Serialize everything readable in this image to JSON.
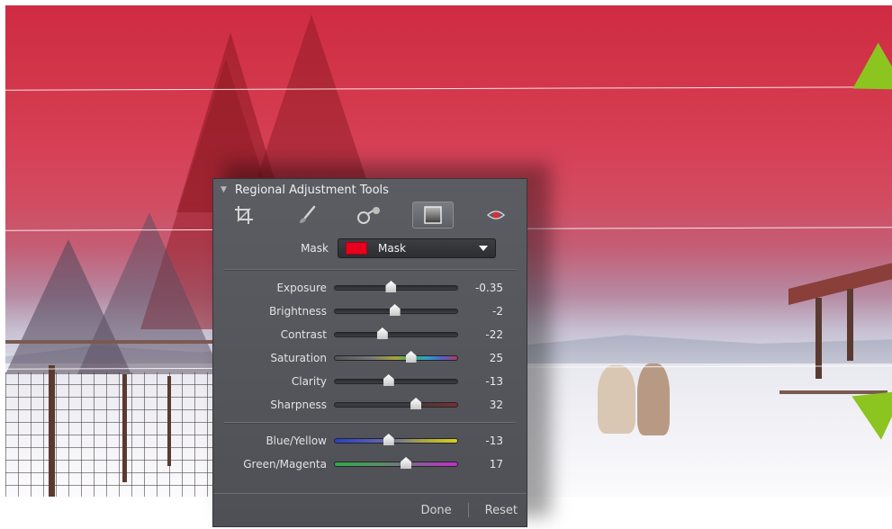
{
  "panel": {
    "title": "Regional Adjustment Tools",
    "tools": [
      {
        "name": "crop-tool",
        "icon": "crop-icon",
        "active": false
      },
      {
        "name": "brush-tool",
        "icon": "brush-icon",
        "active": false
      },
      {
        "name": "selective-tool",
        "icon": "selective-point-icon",
        "active": false
      },
      {
        "name": "gradient-tool",
        "icon": "gradient-square-icon",
        "active": true
      },
      {
        "name": "redeye-tool",
        "icon": "eye-icon",
        "active": false
      }
    ],
    "mask": {
      "label": "Mask",
      "value": "Mask",
      "swatch_color": "#e6001e"
    },
    "sliders_primary": [
      {
        "label": "Exposure",
        "value": "-0.35",
        "position": 0.46,
        "gradient": "gray"
      },
      {
        "label": "Brightness",
        "value": "-2",
        "position": 0.49,
        "gradient": "gray"
      },
      {
        "label": "Contrast",
        "value": "-22",
        "position": 0.39,
        "gradient": "gray"
      },
      {
        "label": "Saturation",
        "value": "25",
        "position": 0.62,
        "gradient": "saturation"
      },
      {
        "label": "Clarity",
        "value": "-13",
        "position": 0.44,
        "gradient": "gray"
      },
      {
        "label": "Sharpness",
        "value": "32",
        "position": 0.66,
        "gradient": "sharpness"
      }
    ],
    "sliders_color": [
      {
        "label": "Blue/Yellow",
        "value": "-13",
        "position": 0.44,
        "gradient": "blueyellow"
      },
      {
        "label": "Green/Magenta",
        "value": "17",
        "position": 0.58,
        "gradient": "greenmagenta"
      }
    ],
    "done_label": "Done",
    "reset_label": "Reset"
  },
  "colors": {
    "mask_overlay": "#d0304a",
    "panel_bg": "#55575c",
    "arrow_green": "#8cc420"
  }
}
